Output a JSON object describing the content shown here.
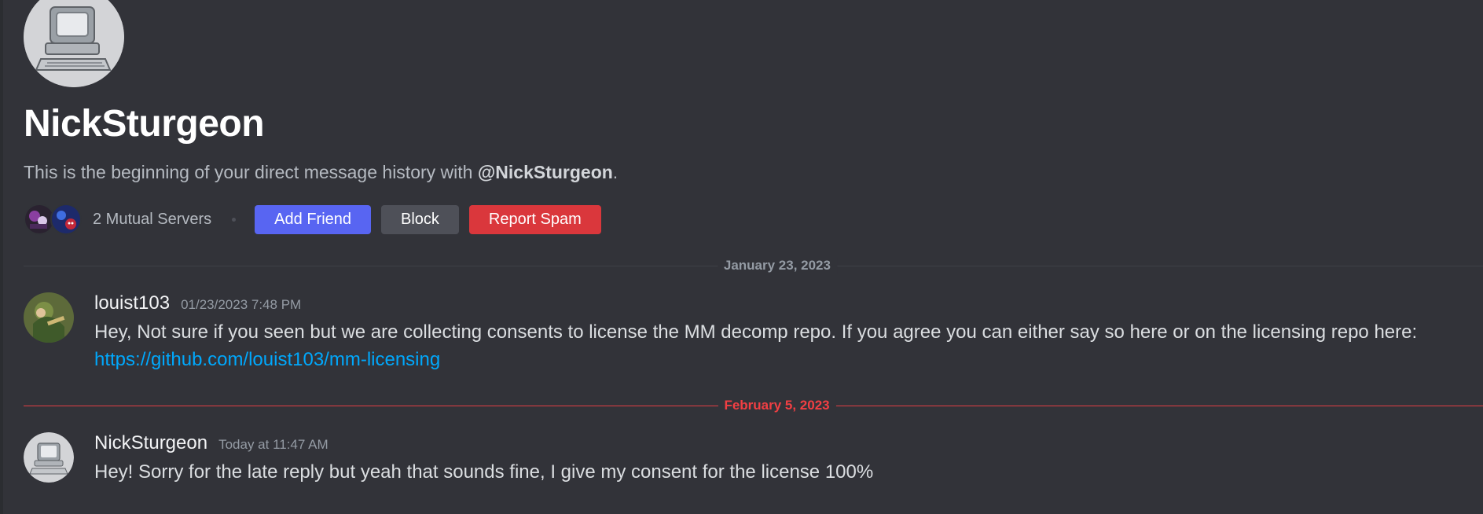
{
  "profile": {
    "name": "NickSturgeon",
    "intro_prefix": "This is the beginning of your direct message history with ",
    "intro_handle": "@NickSturgeon",
    "intro_suffix": ".",
    "mutual_servers_label": "2 Mutual Servers",
    "buttons": {
      "add_friend": "Add Friend",
      "block": "Block",
      "report_spam": "Report Spam"
    }
  },
  "dividers": {
    "first": "January 23, 2023",
    "second": "February 5, 2023"
  },
  "messages": [
    {
      "username": "louist103",
      "timestamp": "01/23/2023 7:48 PM",
      "text": "Hey, Not sure if you seen but we are collecting consents to license the MM decomp repo. If you agree you can either say so here or on the licensing repo here:",
      "link": "https://github.com/louist103/mm-licensing"
    },
    {
      "username": "NickSturgeon",
      "timestamp": "Today at 11:47 AM",
      "text": "Hey! Sorry for the late reply but yeah that sounds fine, I give my consent for the license 100%"
    }
  ],
  "colors": {
    "background": "#323339",
    "primary": "#5865f2",
    "secondary": "#4e5058",
    "danger": "#da373c",
    "link": "#00a8fc",
    "new_divider": "#f23f43"
  },
  "icons": {
    "avatar": "retro-computer-avatar",
    "user_avatar": "link-character-avatar"
  }
}
